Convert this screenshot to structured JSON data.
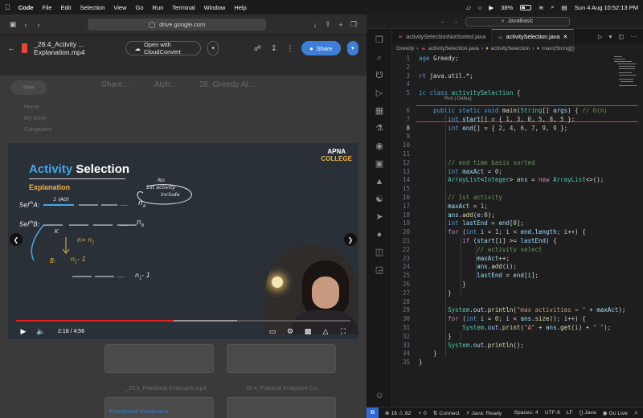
{
  "menubar": {
    "app": "Code",
    "items": [
      "File",
      "Edit",
      "Selection",
      "View",
      "Go",
      "Run",
      "Terminal",
      "Window",
      "Help"
    ],
    "battery": "38%",
    "datetime": "Sun 4 Aug  10:52:13 PM"
  },
  "browser": {
    "url": "drive.google.com",
    "file_name": "_28.4_Activity ... Explanation.mp4",
    "open_with": "Open with CloudConvert",
    "share_label": "Share",
    "bg": {
      "new_label": "New",
      "breadcrumbs": [
        "Share...",
        "Alph...",
        "28. Greedy Al..."
      ],
      "nav": [
        "Home",
        "My Drive",
        "Computers"
      ],
      "file_a": "_28.3_Fractional Knapsack.mp4",
      "file_b": "28.4_Practical Knapsack Co...",
      "thumb_title": "Fractional Knapsack"
    }
  },
  "video": {
    "title_a": "Activity",
    "title_b": "Selection",
    "subtitle": "Explanation",
    "logo_line1": "APNA",
    "logo_line2": "COLLEGE",
    "time": "2:18 / 4:56",
    "progress": 0.47,
    "buffered": 0.66,
    "notes": {
      "no": "No",
      "first_activity": "1st activity",
      "include": "include",
      "sel_a": "Sel",
      "sup_a": "th",
      "label_a": "A:",
      "sel_b": "Sel",
      "sup_b": "th",
      "label_b": "B:",
      "a0": "1 (A0)",
      "dots_a": "....",
      "na": "n",
      "na_sub": "A",
      "dots_b": "....",
      "nb": "n",
      "nb_sub": "B",
      "k": "K",
      "cond": "n",
      "cond_rest": "> n",
      "cond_sub": "1",
      "b_label": "B:",
      "n1_minus": "n",
      "n1_sub": "1",
      "n1_tail": "- 1",
      "dots_c": "....",
      "bottom": "n",
      "bottom_sub": "1",
      "bottom_tail": "- 1"
    }
  },
  "vscode": {
    "search": "JavaBasic",
    "tabs": [
      "activitySelectionNotSorted.java",
      "activitySelection.java"
    ],
    "breadcrumbs": [
      "Greedy",
      "activitySelection.java",
      "activitySelection",
      "main(String[])"
    ],
    "codelens": "Run | Debug",
    "lines": [
      {
        "n": "1",
        "html": "<span class=\"k\">age</span> <span class=\"p\">Greedy;</span>"
      },
      {
        "n": "2",
        "html": ""
      },
      {
        "n": "3",
        "html": "<span class=\"k\">rt</span> <span class=\"p\">java.util.*;</span>"
      },
      {
        "n": "4",
        "html": ""
      },
      {
        "n": "5",
        "html": "<span class=\"k\">ic class</span> <span class=\"t\">activitySelection</span> <span class=\"p\">{</span>"
      },
      {
        "n": "6",
        "html": "    <span class=\"k\">public static void</span> <span class=\"f\">main</span><span class=\"p\">(</span><span class=\"t\">String</span><span class=\"p\">[] </span><span class=\"v\">args</span><span class=\"p\">) { </span><span class=\"c\">// O(n)</span>"
      },
      {
        "n": "7",
        "html": "        <span class=\"k\">int</span> <span class=\"v\">start</span><span class=\"p\">[] = { </span><span class=\"n\">1</span><span class=\"p\">, </span><span class=\"n\">3</span><span class=\"p\">, </span><span class=\"n\">0</span><span class=\"p\">, </span><span class=\"n\">5</span><span class=\"p\">, </span><span class=\"n\">8</span><span class=\"p\">, </span><span class=\"n\">5</span><span class=\"p\"> };</span>"
      },
      {
        "n": "8",
        "html": "        <span class=\"k\">int</span> <span class=\"v\">end</span><span class=\"p\">[] = { </span><span class=\"n\">2</span><span class=\"p\">, </span><span class=\"n\">4</span><span class=\"p\">, </span><span class=\"n\">6</span><span class=\"p\">, </span><span class=\"n\">7</span><span class=\"p\">, </span><span class=\"n\">9</span><span class=\"p\">, </span><span class=\"n\">9</span><span class=\"p\"> };</span>"
      },
      {
        "n": "9",
        "html": ""
      },
      {
        "n": "10",
        "html": ""
      },
      {
        "n": "11",
        "html": ""
      },
      {
        "n": "12",
        "html": "        <span class=\"c\">// end time basis sorted</span>"
      },
      {
        "n": "13",
        "html": "        <span class=\"k\">int</span> <span class=\"v\">maxAct</span><span class=\"p\"> = </span><span class=\"n\">0</span><span class=\"p\">;</span>"
      },
      {
        "n": "14",
        "html": "        <span class=\"t\">ArrayList</span><span class=\"p\">&lt;</span><span class=\"t\">Integer</span><span class=\"p\">&gt; </span><span class=\"v\">ans</span><span class=\"p\"> = </span><span class=\"kc\">new</span> <span class=\"t\">ArrayList</span><span class=\"p\">&lt;&gt;();</span>"
      },
      {
        "n": "15",
        "html": ""
      },
      {
        "n": "16",
        "html": "        <span class=\"c\">// 1st activity</span>"
      },
      {
        "n": "17",
        "html": "        <span class=\"v\">maxAct</span><span class=\"p\"> = </span><span class=\"n\">1</span><span class=\"p\">;</span>"
      },
      {
        "n": "18",
        "html": "        <span class=\"v\">ans</span><span class=\"p\">.</span><span class=\"f\">add</span><span class=\"p\">(</span><span class=\"v\">e</span><span class=\"p\">:</span><span class=\"n\">0</span><span class=\"p\">);</span>"
      },
      {
        "n": "19",
        "html": "        <span class=\"k\">int</span> <span class=\"v\">lastEnd</span><span class=\"p\"> = </span><span class=\"v\">end</span><span class=\"p\">[</span><span class=\"n\">0</span><span class=\"p\">];</span>"
      },
      {
        "n": "20",
        "html": "        <span class=\"kc\">for</span> <span class=\"p\">(</span><span class=\"k\">int</span> <span class=\"v\">i</span><span class=\"p\"> = </span><span class=\"n\">1</span><span class=\"p\">; </span><span class=\"v\">i</span><span class=\"p\"> &lt; </span><span class=\"v\">end</span><span class=\"p\">.</span><span class=\"v\">length</span><span class=\"p\">; </span><span class=\"v\">i</span><span class=\"p\">++) {</span>"
      },
      {
        "n": "21",
        "html": "            <span class=\"kc\">if</span> <span class=\"p\">(</span><span class=\"v\">start</span><span class=\"p\">[</span><span class=\"v\">i</span><span class=\"p\">] &gt;= </span><span class=\"v\">lastEnd</span><span class=\"p\">) {</span>"
      },
      {
        "n": "22",
        "html": "                <span class=\"c\">// activity select</span>"
      },
      {
        "n": "23",
        "html": "                <span class=\"v\">maxAct</span><span class=\"p\">++;</span>"
      },
      {
        "n": "24",
        "html": "                <span class=\"v\">ans</span><span class=\"p\">.</span><span class=\"f\">add</span><span class=\"p\">(</span><span class=\"v\">i</span><span class=\"p\">);</span>"
      },
      {
        "n": "25",
        "html": "                <span class=\"v\">lastEnd</span><span class=\"p\"> = </span><span class=\"v\">end</span><span class=\"p\">[</span><span class=\"v\">i</span><span class=\"p\">];</span>"
      },
      {
        "n": "26",
        "html": "            <span class=\"p\">}</span>"
      },
      {
        "n": "27",
        "html": "        <span class=\"p\">}</span>"
      },
      {
        "n": "28",
        "html": ""
      },
      {
        "n": "29",
        "html": "        <span class=\"t\">System</span><span class=\"p\">.</span><span class=\"v\">out</span><span class=\"p\">.</span><span class=\"f\">println</span><span class=\"p\">(</span><span class=\"s\">\"max activities = \"</span><span class=\"p\"> + </span><span class=\"v\">maxAct</span><span class=\"p\">);</span>"
      },
      {
        "n": "30",
        "html": "        <span class=\"kc\">for</span> <span class=\"p\">(</span><span class=\"k\">int</span> <span class=\"v\">i</span><span class=\"p\"> = </span><span class=\"n\">0</span><span class=\"p\">; </span><span class=\"v\">i</span><span class=\"p\"> &lt; </span><span class=\"v\">ans</span><span class=\"p\">.</span><span class=\"f\">size</span><span class=\"p\">(); </span><span class=\"v\">i</span><span class=\"p\">++) {</span>"
      },
      {
        "n": "31",
        "html": "            <span class=\"t\">System</span><span class=\"p\">.</span><span class=\"v\">out</span><span class=\"p\">.</span><span class=\"f\">print</span><span class=\"p\">(</span><span class=\"s\">\"A\"</span><span class=\"p\"> + </span><span class=\"v\">ans</span><span class=\"p\">.</span><span class=\"f\">get</span><span class=\"p\">(</span><span class=\"v\">i</span><span class=\"p\">) + </span><span class=\"s\">\" \"</span><span class=\"p\">);</span>"
      },
      {
        "n": "32",
        "html": "        <span class=\"p\">}</span>"
      },
      {
        "n": "33",
        "html": "        <span class=\"t\">System</span><span class=\"p\">.</span><span class=\"v\">out</span><span class=\"p\">.</span><span class=\"f\">println</span><span class=\"p\">();</span>"
      },
      {
        "n": "34",
        "html": "    <span class=\"p\">}</span>"
      },
      {
        "n": "35",
        "html": "<span class=\"p\">}</span>"
      }
    ],
    "status": {
      "problems": "16",
      "warnings": "82",
      "info": "0",
      "connect": "Connect",
      "java": "Java: Ready",
      "spaces": "Spaces: 4",
      "encoding": "UTF-8",
      "eol": "LF",
      "lang": "Java",
      "golive": "Go Live"
    }
  },
  "colors": {
    "accent_blue": "#3c7ed8",
    "error_red": "#f14c4c",
    "video_title_blue": "#46a6e8",
    "video_accent_yellow": "#f2b33c"
  }
}
